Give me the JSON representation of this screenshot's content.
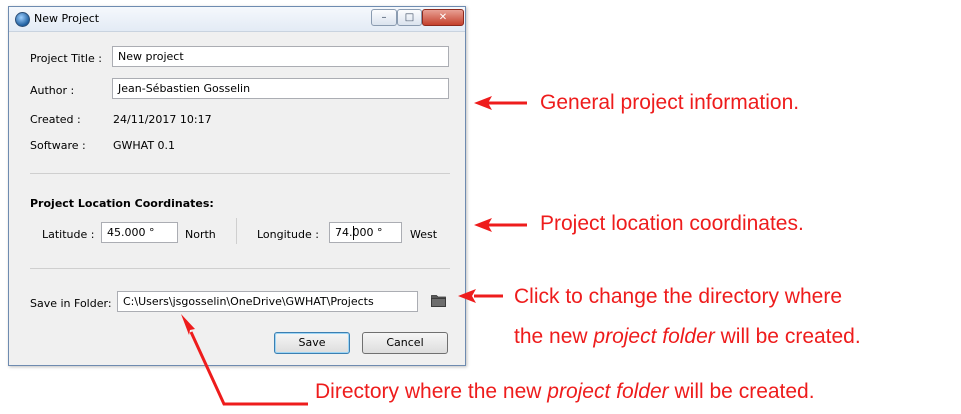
{
  "window": {
    "title": "New Project",
    "controls": {
      "minimize": "–",
      "maximize": "□",
      "close": "✕"
    }
  },
  "form": {
    "title_label": "Project Title :",
    "title_value": "New project",
    "author_label": "Author :",
    "author_value": "Jean-Sébastien Gosselin",
    "created_label": "Created :",
    "created_value": "24/11/2017 10:17",
    "software_label": "Software :",
    "software_value": "GWHAT 0.1",
    "coords_heading": "Project Location Coordinates:",
    "latitude_label": "Latitude :",
    "latitude_value": "45.000 °",
    "latitude_dir": "North",
    "longitude_label": "Longitude :",
    "longitude_value": "74.000 °",
    "longitude_dir": "West",
    "folder_label": "Save in Folder:",
    "folder_value": "C:\\Users\\jsgosselin\\OneDrive\\GWHAT\\Projects",
    "save_label": "Save",
    "cancel_label": "Cancel"
  },
  "annotations": {
    "general": "General project information.",
    "location": "Project location coordinates.",
    "change_dir_line1": "Click to change the directory where",
    "change_dir_line2_pre": "the new ",
    "change_dir_line2_em": "project folder",
    "change_dir_line2_post": " will be created.",
    "directory_pre": "Directory where the new ",
    "directory_em": "project folder",
    "directory_post": " will be created."
  },
  "colors": {
    "annotation": "#ee1c1c",
    "dialog_bg": "#f0f0f0"
  },
  "icons": {
    "app": "app-globe-icon",
    "folder": "folder-icon"
  }
}
